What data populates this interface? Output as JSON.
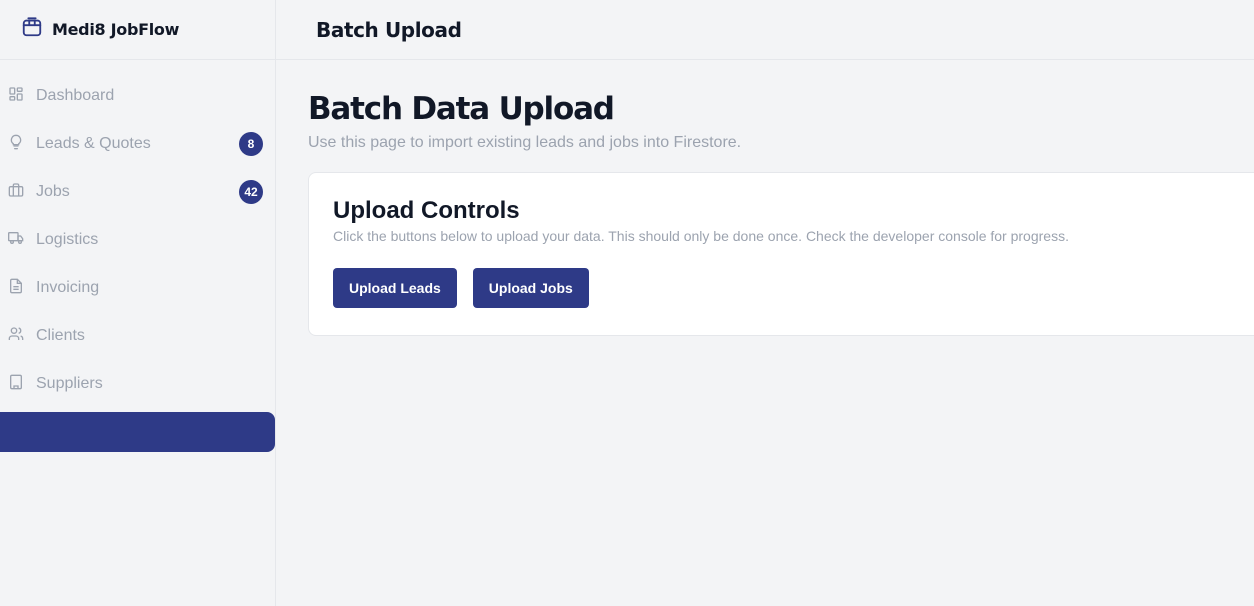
{
  "app": {
    "name": "Medi8 JobFlow",
    "logo_icon": "package-icon"
  },
  "sidebar": {
    "items": [
      {
        "label": "Dashboard",
        "icon": "dashboard-icon"
      },
      {
        "label": "Leads & Quotes",
        "icon": "lightbulb-icon",
        "badge": "8"
      },
      {
        "label": "Jobs",
        "icon": "briefcase-icon",
        "badge": "42"
      },
      {
        "label": "Logistics",
        "icon": "truck-icon"
      },
      {
        "label": "Invoicing",
        "icon": "document-icon"
      },
      {
        "label": "Clients",
        "icon": "users-icon"
      },
      {
        "label": "Suppliers",
        "icon": "building-icon"
      }
    ],
    "active_item_label": ""
  },
  "header": {
    "title": "Batch Upload"
  },
  "main": {
    "title": "Batch Data Upload",
    "subtitle": "Use this page to import existing leads and jobs into Firestore.",
    "card": {
      "title": "Upload Controls",
      "description": "Click the buttons below to upload your data. This should only be done once. Check the developer console for progress.",
      "buttons": {
        "upload_leads": "Upload Leads",
        "upload_jobs": "Upload Jobs"
      }
    }
  },
  "colors": {
    "accent": "#2e3a87",
    "background": "#f3f4f6",
    "muted_text": "#9ca3af"
  }
}
